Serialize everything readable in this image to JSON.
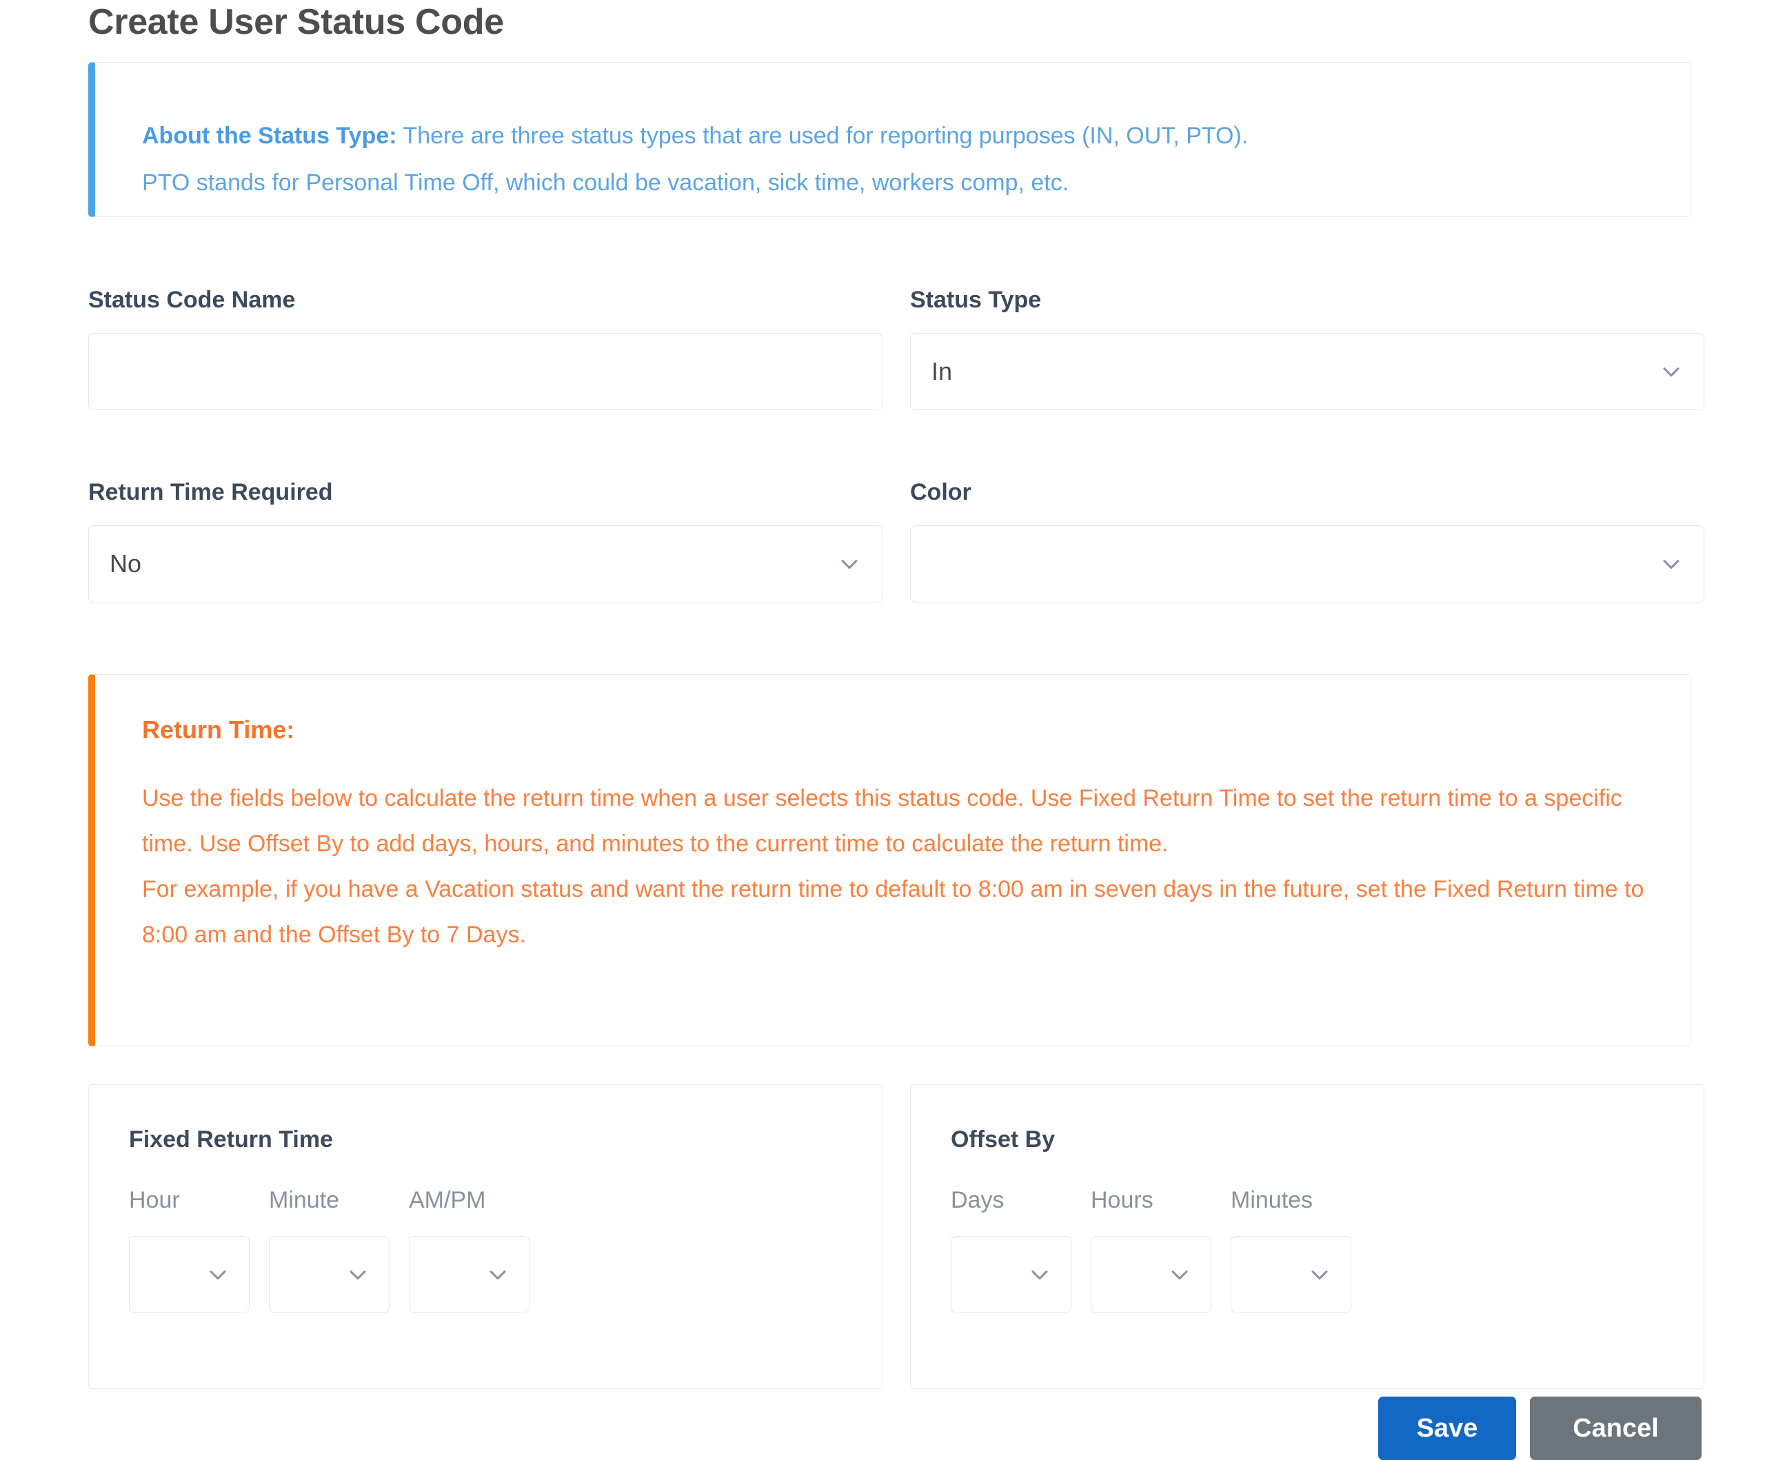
{
  "page": {
    "title": "Create User Status Code"
  },
  "info_callout": {
    "name": "status-type-info",
    "accent_color": "#4da3e8",
    "lead": "About the Status Type:",
    "line1": " There are three status types that are used for reporting purposes (IN, OUT, PTO).",
    "line2": "PTO stands for Personal Time Off, which could be vacation, sick time, workers comp, etc."
  },
  "form": {
    "status_code_name": {
      "label": "Status Code Name",
      "value": "",
      "placeholder": ""
    },
    "status_type": {
      "label": "Status Type",
      "value": "In",
      "icon": "chevron-down-icon"
    },
    "return_time_required": {
      "label": "Return Time Required",
      "value": "No",
      "icon": "chevron-down-icon"
    },
    "color": {
      "label": "Color",
      "value": "",
      "icon": "chevron-down-icon"
    }
  },
  "warn_callout": {
    "name": "return-time-warning",
    "accent_color": "#f97f14",
    "title": "Return Time:",
    "paragraph1": "Use the fields below to calculate the return time when a user selects this status code. Use Fixed Return Time to set the return time to a specific time. Use Offset By to add days, hours, and minutes to the current time to calculate the return time.",
    "paragraph2": "For example, if you have a Vacation status and want the return time to default to 8:00 am in seven days in the future, set the Fixed Return time to 8:00 am and the Offset By to 7 Days."
  },
  "fixed_return_time": {
    "title": "Fixed Return Time",
    "fields": [
      {
        "label": "Hour",
        "value": "",
        "icon": "chevron-down-icon"
      },
      {
        "label": "Minute",
        "value": "",
        "icon": "chevron-down-icon"
      },
      {
        "label": "AM/PM",
        "value": "",
        "icon": "chevron-down-icon"
      }
    ]
  },
  "offset_by": {
    "title": "Offset By",
    "fields": [
      {
        "label": "Days",
        "value": "",
        "icon": "chevron-down-icon"
      },
      {
        "label": "Hours",
        "value": "",
        "icon": "chevron-down-icon"
      },
      {
        "label": "Minutes",
        "value": "",
        "icon": "chevron-down-icon"
      }
    ]
  },
  "footer": {
    "save_label": "Save",
    "cancel_label": "Cancel",
    "save_color": "#1268c3",
    "cancel_color": "#6c757d"
  }
}
